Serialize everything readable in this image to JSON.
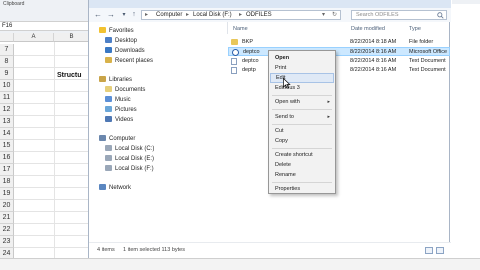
{
  "excel": {
    "clipboard_label": "Clipboard",
    "namebox": "F16",
    "columns": [
      "A",
      "B"
    ],
    "rows": [
      "7",
      "8",
      "9",
      "10",
      "11",
      "12",
      "13",
      "14",
      "15",
      "16",
      "17",
      "18",
      "19",
      "20",
      "21",
      "22",
      "23",
      "24"
    ],
    "cell_text": "Structu"
  },
  "explorer": {
    "address": {
      "segments": [
        "Computer",
        "Local Disk (F:)",
        "ODFILES"
      ]
    },
    "search": {
      "placeholder": "Search ODFILES"
    },
    "nav": {
      "favorites_header": "Favorites",
      "favorites": [
        "Desktop",
        "Downloads",
        "Recent places"
      ],
      "libraries_header": "Libraries",
      "libraries": [
        "Documents",
        "Music",
        "Pictures",
        "Videos"
      ],
      "computer_header": "Computer",
      "drives": [
        "Local Disk (C:)",
        "Local Disk (E:)",
        "Local Disk (F:)"
      ],
      "network": "Network"
    },
    "columns": {
      "name": "Name",
      "date": "Date modified",
      "type": "Type"
    },
    "files": [
      {
        "name": "BKP",
        "date": "8/22/2014 8:18 AM",
        "type": "File folder"
      },
      {
        "name": "deptco",
        "date": "8/22/2014 8:16 AM",
        "type": "Microsoft Office E..."
      },
      {
        "name": "deptco",
        "date": "8/22/2014 8:16 AM",
        "type": "Text Document"
      },
      {
        "name": "deptp",
        "date": "8/22/2014 8:16 AM",
        "type": "Text Document"
      }
    ],
    "status": {
      "items": "4 items",
      "selected": "1 item selected  113 bytes"
    }
  },
  "context_menu": {
    "items": [
      {
        "label": "Open",
        "bold": true
      },
      {
        "label": "Print"
      },
      {
        "label": "Edit"
      },
      {
        "label": "EditPlus 3"
      },
      {
        "label": "Open with"
      },
      {
        "label": "Send to"
      },
      {
        "label": "Cut"
      },
      {
        "label": "Copy"
      },
      {
        "label": "Create shortcut"
      },
      {
        "label": "Delete"
      },
      {
        "label": "Rename"
      },
      {
        "label": "Properties"
      }
    ]
  }
}
